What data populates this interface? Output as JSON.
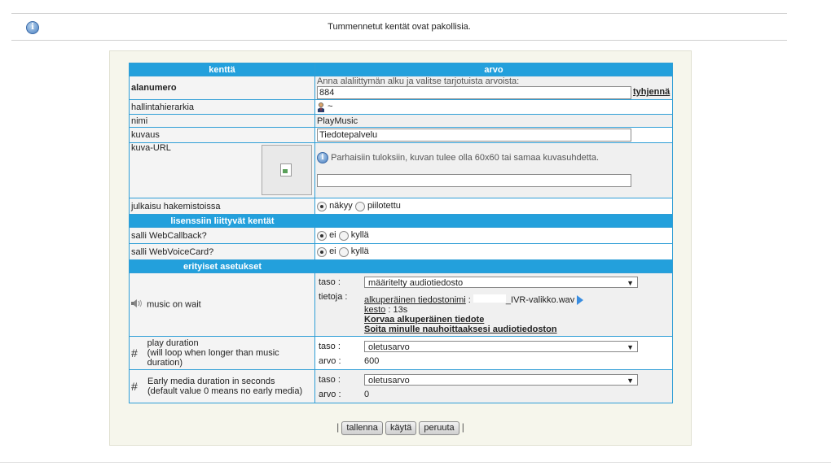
{
  "notice": {
    "text": "Tummennetut kentät ovat pakollisia."
  },
  "table": {
    "col_field": "kenttä",
    "col_value": "arvo",
    "alanumero": {
      "label": "alanumero",
      "hint": "Anna alaliittymän alku ja valitse tarjotuista arvoista:",
      "value": "884",
      "clear_link": "tyhjennä"
    },
    "hallinta": {
      "label": "hallintahierarkia",
      "value": "~"
    },
    "nimi": {
      "label": "nimi",
      "value": "PlayMusic"
    },
    "kuvaus": {
      "label": "kuvaus",
      "value": "Tiedotepalvelu"
    },
    "kuva_url": {
      "label": "kuva-URL",
      "hint": "Parhaisiin tuloksiin, kuvan tulee olla 60x60 tai samaa kuvasuhdetta.",
      "value": ""
    },
    "julkaisu": {
      "label": "julkaisu hakemistoissa",
      "opt1": "näkyy",
      "opt2": "piilotettu"
    },
    "section_license": "lisenssiin liittyvät kentät",
    "webcallback": {
      "label": "salli WebCallback?",
      "opt1": "ei",
      "opt2": "kyllä"
    },
    "webvoicecard": {
      "label": "salli WebVoiceCard?",
      "opt1": "ei",
      "opt2": "kyllä"
    },
    "section_special": "erityiset asetukset",
    "music": {
      "label": "music on wait",
      "taso_label": "taso :",
      "taso_value": "määritelty audiotiedosto",
      "tietoja_label": "tietoja :",
      "original_label": "alkuperäinen tiedostonimi",
      "filename": "_IVR-valikko.wav",
      "kesto_label": "kesto",
      "kesto_value": ": 13s",
      "replace_link": "Korvaa alkuperäinen tiedote",
      "record_link": "Soita minulle nauhoittaaksesi audiotiedoston"
    },
    "play_duration": {
      "label": "play duration",
      "sublabel": "(will loop when longer than music duration)",
      "taso_label": "taso :",
      "taso_value": "oletusarvo",
      "arvo_label": "arvo :",
      "arvo_value": "600"
    },
    "early_media": {
      "label": "Early media duration in seconds",
      "sublabel": "(default value 0 means no early media)",
      "taso_label": "taso :",
      "taso_value": "oletusarvo",
      "arvo_label": "arvo :",
      "arvo_value": "0"
    }
  },
  "buttons": {
    "save": "tallenna",
    "apply": "käytä",
    "cancel": "peruuta"
  }
}
